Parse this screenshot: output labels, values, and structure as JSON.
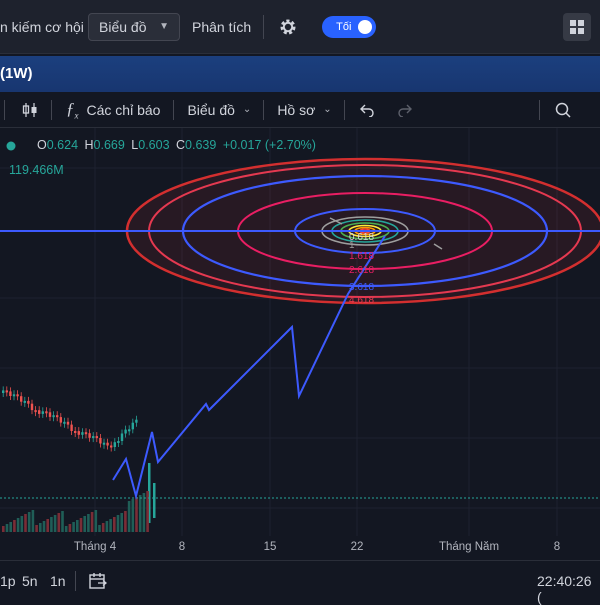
{
  "topbar": {
    "search_label": "n kiếm cơ hội",
    "chart_select": "Biểu đồ",
    "analysis": "Phân tích",
    "theme_toggle": "Tối"
  },
  "symbol_bar": {
    "interval": "(1W)"
  },
  "toolbar": {
    "indicators": "Các chỉ báo",
    "chart": "Biểu đồ",
    "profile": "Hồ sơ"
  },
  "legend": {
    "o_label": "O",
    "o": "0.624",
    "h_label": "H",
    "h": "0.669",
    "l_label": "L",
    "l": "0.603",
    "c_label": "C",
    "c": "0.639",
    "change": "+0.017 (+2.70%)",
    "volume": "119.466M"
  },
  "fib_labels": [
    "0.618",
    "1",
    "1.618",
    "2.618",
    "3.618",
    "4.618"
  ],
  "xaxis": {
    "labels": [
      "Tháng 4",
      "8",
      "15",
      "22",
      "Tháng Năm",
      "8"
    ]
  },
  "bottombar": {
    "tf1": "1p",
    "tf2": "5n",
    "tf3": "1n",
    "clock": "22:40:26 ("
  },
  "colors": {
    "background": "#131722",
    "accent": "#2962ff",
    "up": "#26a69a",
    "down": "#ef5350",
    "projection": "#3d5afe"
  }
}
